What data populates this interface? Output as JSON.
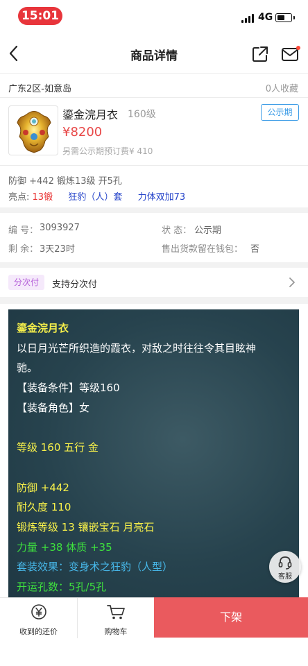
{
  "status_bar": {
    "time": "15:01",
    "network": "4G",
    "battery_level": 0.55
  },
  "nav": {
    "title": "商品详情"
  },
  "seller": {
    "server": "广东2区-如意岛",
    "favorites": "0人收藏"
  },
  "item": {
    "name": "鎏金浣月衣",
    "level": "160级",
    "status": "公示期",
    "price": "¥8200",
    "deposit": "另需公示期预订费¥ 410",
    "attributes": "防御 +442 锻炼13级 开5孔",
    "highlights_label": "亮点:",
    "highlights": [
      "13锻",
      "狂豹（人）套",
      "力体双加73"
    ]
  },
  "info": {
    "id_label": "编    号：",
    "id_value": "3093927",
    "state_label": "状    态：",
    "state_value": "公示期",
    "remaining_label": "剩    余：",
    "remaining_value": "3天23时",
    "wallet_label": "售出货款留在钱包：",
    "wallet_value": "否"
  },
  "installment": {
    "badge": "分次付",
    "text": "支持分次付"
  },
  "description": [
    {
      "text": "鎏金浣月衣",
      "color": "yellow",
      "bold": true
    },
    {
      "text": "以日月光芒所织造的霞衣，对敌之时往往令其目眩神",
      "color": "white"
    },
    {
      "text": "驰。",
      "color": "white"
    },
    {
      "text": "【装备条件】等级160",
      "color": "white"
    },
    {
      "text": "【装备角色】女",
      "color": "white"
    },
    {
      "text": "",
      "color": "white"
    },
    {
      "text": "等级 160  五行 金",
      "color": "yellow"
    },
    {
      "text": "",
      "color": "white"
    },
    {
      "text": "防御 +442",
      "color": "yellow"
    },
    {
      "text": "耐久度 110",
      "color": "yellow"
    },
    {
      "text": "锻炼等级 13  镶嵌宝石 月亮石",
      "color": "yellow"
    },
    {
      "text": "力量 +38  体质 +35",
      "color": "green"
    },
    {
      "text": "套装效果：变身术之狂豹（人型）",
      "color": "cyan"
    },
    {
      "text": "开运孔数：5孔/5孔",
      "color": "green"
    }
  ],
  "customer_service": {
    "label": "客服"
  },
  "bottom_bar": {
    "counter_offer_label": "收到的还价",
    "cart_label": "购物车",
    "offshelf_label": "下架"
  },
  "colors": {
    "accent_red": "#ea5a5e",
    "status_blue": "#3a9be6",
    "price_red": "#e84848"
  }
}
